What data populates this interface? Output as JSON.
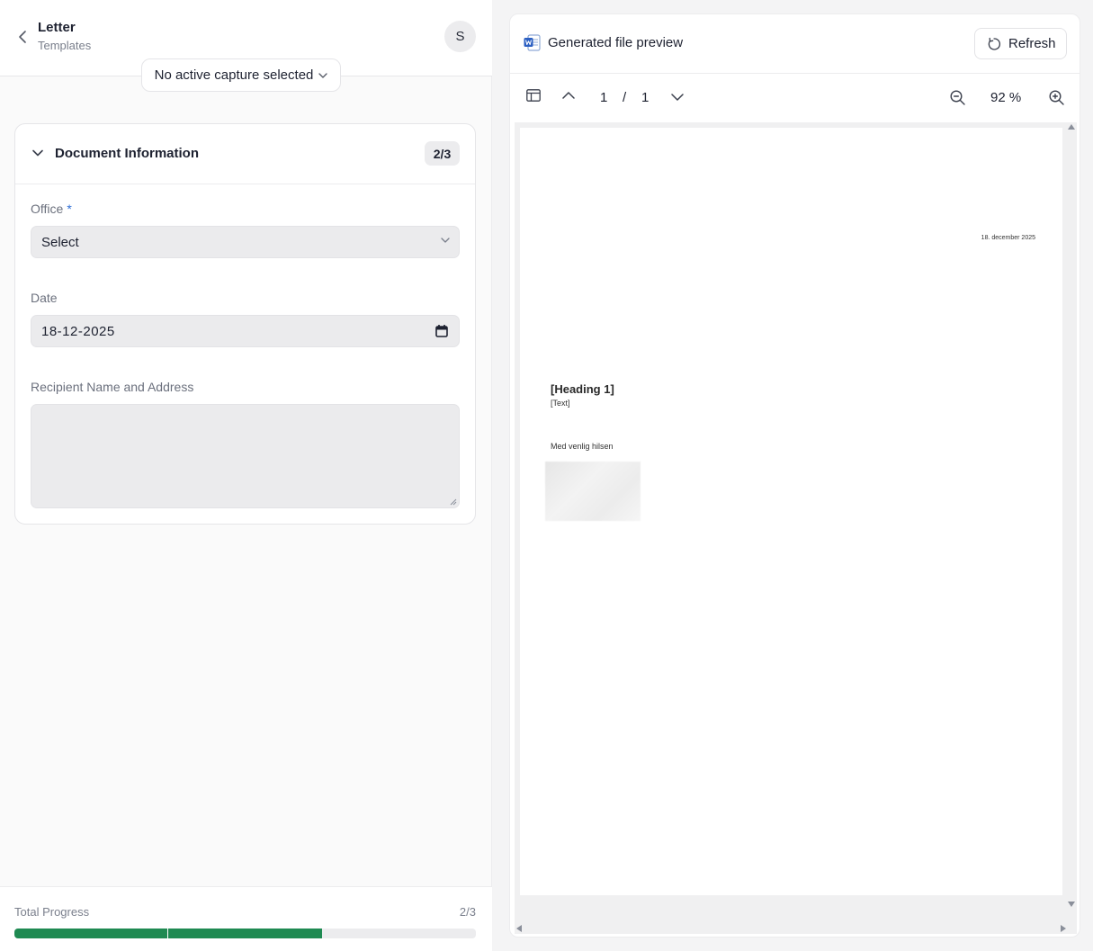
{
  "header": {
    "title": "Letter",
    "subtitle": "Templates",
    "avatar_initial": "S",
    "capture_selector": "No active capture selected"
  },
  "section": {
    "title": "Document Information",
    "badge": "2/3",
    "fields": {
      "office": {
        "label": "Office",
        "required_mark": "*",
        "value": "Select"
      },
      "date": {
        "label": "Date",
        "value": "18-12-2025"
      },
      "recipient": {
        "label": "Recipient Name and Address",
        "value": ""
      }
    }
  },
  "progress": {
    "label": "Total Progress",
    "count": "2/3",
    "completed": 2,
    "total": 3,
    "color": "#1f8a52"
  },
  "preview": {
    "title": "Generated file preview",
    "refresh_label": "Refresh",
    "page_current": "1",
    "page_separator": "/",
    "page_total": "1",
    "zoom": "92 %",
    "document": {
      "date": "18. december 2025",
      "heading": "[Heading 1]",
      "text": "[Text]",
      "closing": "Med venlig hilsen"
    }
  },
  "icons": [
    "chevron-left-icon",
    "chevron-down-icon",
    "calendar-icon",
    "word-doc-icon",
    "refresh-icon",
    "sidebar-layout-icon",
    "chevron-up-icon",
    "zoom-out-icon",
    "zoom-in-icon"
  ]
}
